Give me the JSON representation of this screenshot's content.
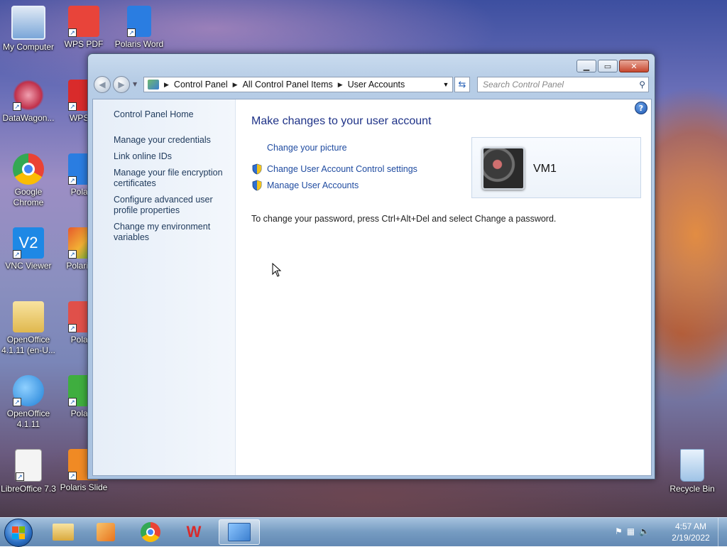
{
  "desktop": {
    "icons": [
      {
        "label": "My Computer",
        "color": "#3a8ee6"
      },
      {
        "label": "WPS PDF",
        "color": "#e8443a"
      },
      {
        "label": "Polaris Word",
        "color": "#2a7de1"
      },
      {
        "label": "DataWagon...",
        "color": "#c0304a"
      },
      {
        "label": "WPS O",
        "color": "#d92b2b"
      },
      {
        "label": "Google Chrome",
        "color": "#ea4335"
      },
      {
        "label": "Polaris",
        "color": "#2a7de1"
      },
      {
        "label": "VNC Viewer",
        "color": "#1e88e5"
      },
      {
        "label": "Polaris O",
        "color": "#e65a2c"
      },
      {
        "label": "OpenOffice 4.1.11 (en-U...",
        "color": "#e8c66a"
      },
      {
        "label": "Polaris",
        "color": "#e0504a"
      },
      {
        "label": "OpenOffice 4.1.11",
        "color": "#1e7fd6"
      },
      {
        "label": "Polaris",
        "color": "#3fae3f"
      },
      {
        "label": "LibreOffice 7.3",
        "color": "#f2f2f2"
      },
      {
        "label": "Polaris Slide",
        "color": "#f08a24"
      },
      {
        "label": "Recycle Bin",
        "color": "#9fc3e6"
      }
    ]
  },
  "window": {
    "address": {
      "crumbs": [
        "Control Panel",
        "All Control Panel Items",
        "User Accounts"
      ]
    },
    "search_placeholder": "Search Control Panel",
    "sidebar": {
      "home": "Control Panel Home",
      "links": [
        "Manage your credentials",
        "Link online IDs",
        "Manage your file encryption certificates",
        "Configure advanced user profile properties",
        "Change my environment variables"
      ]
    },
    "main": {
      "heading": "Make changes to your user account",
      "tasks": [
        {
          "label": "Change your picture",
          "shield": false
        },
        {
          "label": "Change User Account Control settings",
          "shield": true
        },
        {
          "label": "Manage User Accounts",
          "shield": true
        }
      ],
      "password_note": "To change your password, press Ctrl+Alt+Del and select Change a password.",
      "account_name": "VM1"
    }
  },
  "taskbar": {
    "clock_time": "4:57 AM",
    "clock_date": "2/19/2022",
    "pinned": [
      "file-explorer-icon",
      "media-player-icon",
      "chrome-icon",
      "wps-office-icon",
      "control-panel-icon"
    ]
  },
  "colors": {
    "link": "#1e395b",
    "heading": "#1e3287",
    "accent": "#2a63b8"
  }
}
